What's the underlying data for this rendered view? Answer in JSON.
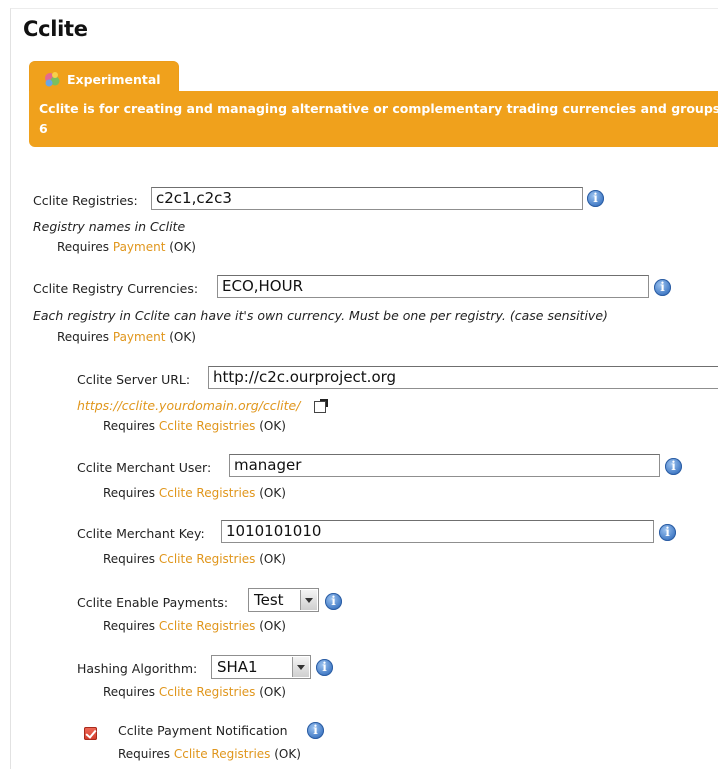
{
  "page": {
    "title": "Cclite"
  },
  "experimental": {
    "tab_label": "Experimental",
    "message_line1": "Cclite is for creating and managing alternative or complementary trading currencies and groups",
    "message_line2": "6"
  },
  "fields": {
    "registries": {
      "label": "Cclite Registries:",
      "value": "c2c1,c2c3",
      "hint": "Registry names in Cclite",
      "requires_prefix": "Requires",
      "requires_link": "Payment",
      "requires_status": "(OK)"
    },
    "currencies": {
      "label": "Cclite Registry Currencies:",
      "value": "ECO,HOUR",
      "hint": "Each registry in Cclite can have it's own currency. Must be one per registry. (case sensitive)",
      "requires_prefix": "Requires",
      "requires_link": "Payment",
      "requires_status": "(OK)"
    },
    "server_url": {
      "label": "Cclite Server URL:",
      "value": "http://c2c.ourproject.org",
      "example_link": "https://cclite.yourdomain.org/cclite/",
      "requires_prefix": "Requires",
      "requires_link": "Cclite Registries",
      "requires_status": "(OK)"
    },
    "merchant_user": {
      "label": "Cclite Merchant User:",
      "value": "manager",
      "requires_prefix": "Requires",
      "requires_link": "Cclite Registries",
      "requires_status": "(OK)"
    },
    "merchant_key": {
      "label": "Cclite Merchant Key:",
      "value": "1010101010",
      "requires_prefix": "Requires",
      "requires_link": "Cclite Registries",
      "requires_status": "(OK)"
    },
    "enable_payments": {
      "label": "Cclite Enable Payments:",
      "selected": "Test",
      "requires_prefix": "Requires",
      "requires_link": "Cclite Registries",
      "requires_status": "(OK)"
    },
    "hashing": {
      "label": "Hashing Algorithm:",
      "selected": "SHA1",
      "requires_prefix": "Requires",
      "requires_link": "Cclite Registries",
      "requires_status": "(OK)"
    },
    "payment_notification": {
      "label": "Cclite Payment Notification",
      "checked": true,
      "requires_prefix": "Requires",
      "requires_link": "Cclite Registries",
      "requires_status": "(OK)"
    }
  },
  "colors": {
    "accent_orange": "#f0a11c",
    "link_orange": "#e0961c",
    "info_blue": "#3f78c4",
    "checkbox_red": "#d23b2a"
  },
  "icons": {
    "experimental": "experimental-icon",
    "info": "info-icon",
    "external_link": "external-link-icon",
    "dropdown": "chevron-down-icon"
  }
}
